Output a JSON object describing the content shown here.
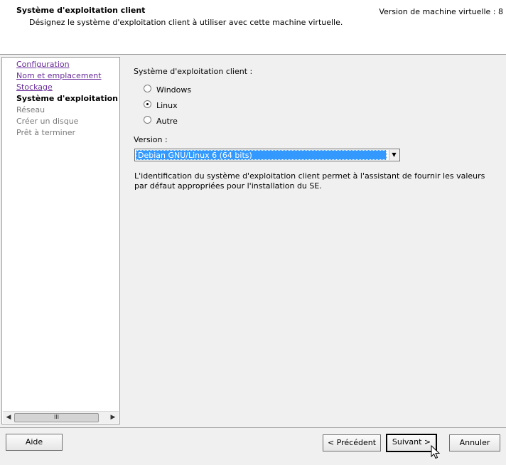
{
  "header": {
    "title": "Système d'exploitation client",
    "subtitle": "Désignez le système d'exploitation client à utiliser avec cette machine virtuelle.",
    "vm_version": "Version de machine virtuelle : 8"
  },
  "nav": {
    "items": [
      {
        "label": "Configuration",
        "state": "link"
      },
      {
        "label": "Nom et emplacement",
        "state": "link"
      },
      {
        "label": "Stockage",
        "state": "link"
      },
      {
        "label": "Système d'exploitation cli",
        "state": "current"
      },
      {
        "label": "Réseau",
        "state": "disabled"
      },
      {
        "label": "Créer un disque",
        "state": "disabled"
      },
      {
        "label": "Prêt à terminer",
        "state": "disabled"
      }
    ],
    "scroll_thumb": "III"
  },
  "content": {
    "os_label": "Système d'exploitation client :",
    "options": [
      "Windows",
      "Linux",
      "Autre"
    ],
    "selected_option": "Linux",
    "version_label": "Version :",
    "version_value": "Debian GNU/Linux 6 (64 bits)",
    "description": "L'identification du système d'exploitation client permet à l'assistant de fournir les valeurs par défaut appropriées pour l'installation du SE."
  },
  "buttons": {
    "help": "Aide",
    "back": "< Précédent",
    "next": "Suivant >",
    "cancel": "Annuler"
  },
  "colors": {
    "link": "#6a2c9c",
    "selection": "#3399ff"
  }
}
